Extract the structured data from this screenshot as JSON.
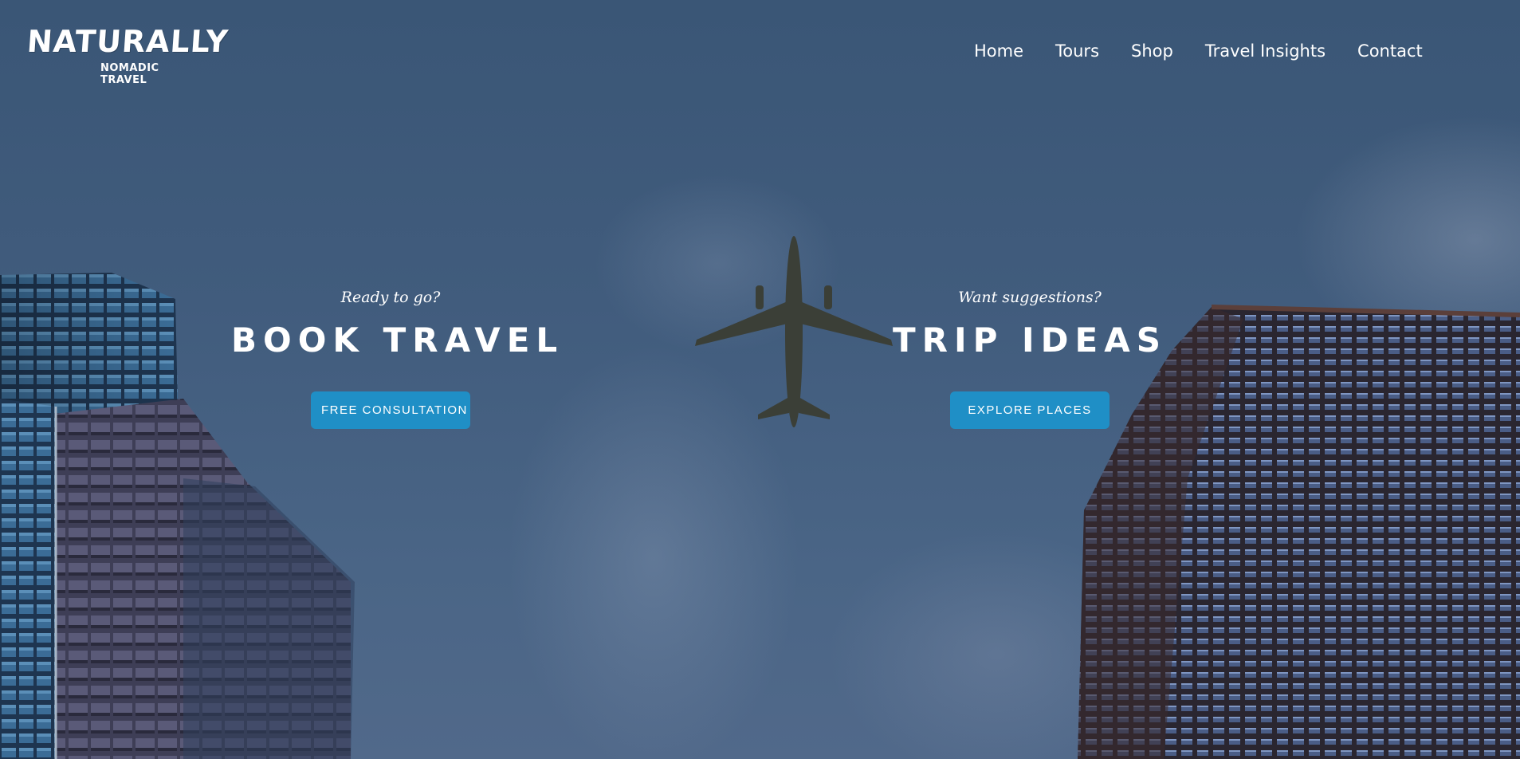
{
  "brand": {
    "name": "NATURALLY",
    "tagline": "NOMADIC TRAVEL"
  },
  "nav": {
    "items": [
      {
        "label": "Home"
      },
      {
        "label": "Tours"
      },
      {
        "label": "Shop"
      },
      {
        "label": "Travel Insights"
      },
      {
        "label": "Contact"
      }
    ]
  },
  "hero": {
    "left": {
      "eyebrow": "Ready to go?",
      "heading": "BOOK TRAVEL",
      "button_label": "FREE CONSULTATION"
    },
    "right": {
      "eyebrow": "Want suggestions?",
      "heading": "TRIP IDEAS",
      "button_label": "EXPLORE PLACES"
    }
  },
  "colors": {
    "accent": "#1f8fc6",
    "sky": "#435d7c",
    "text": "#ffffff"
  }
}
